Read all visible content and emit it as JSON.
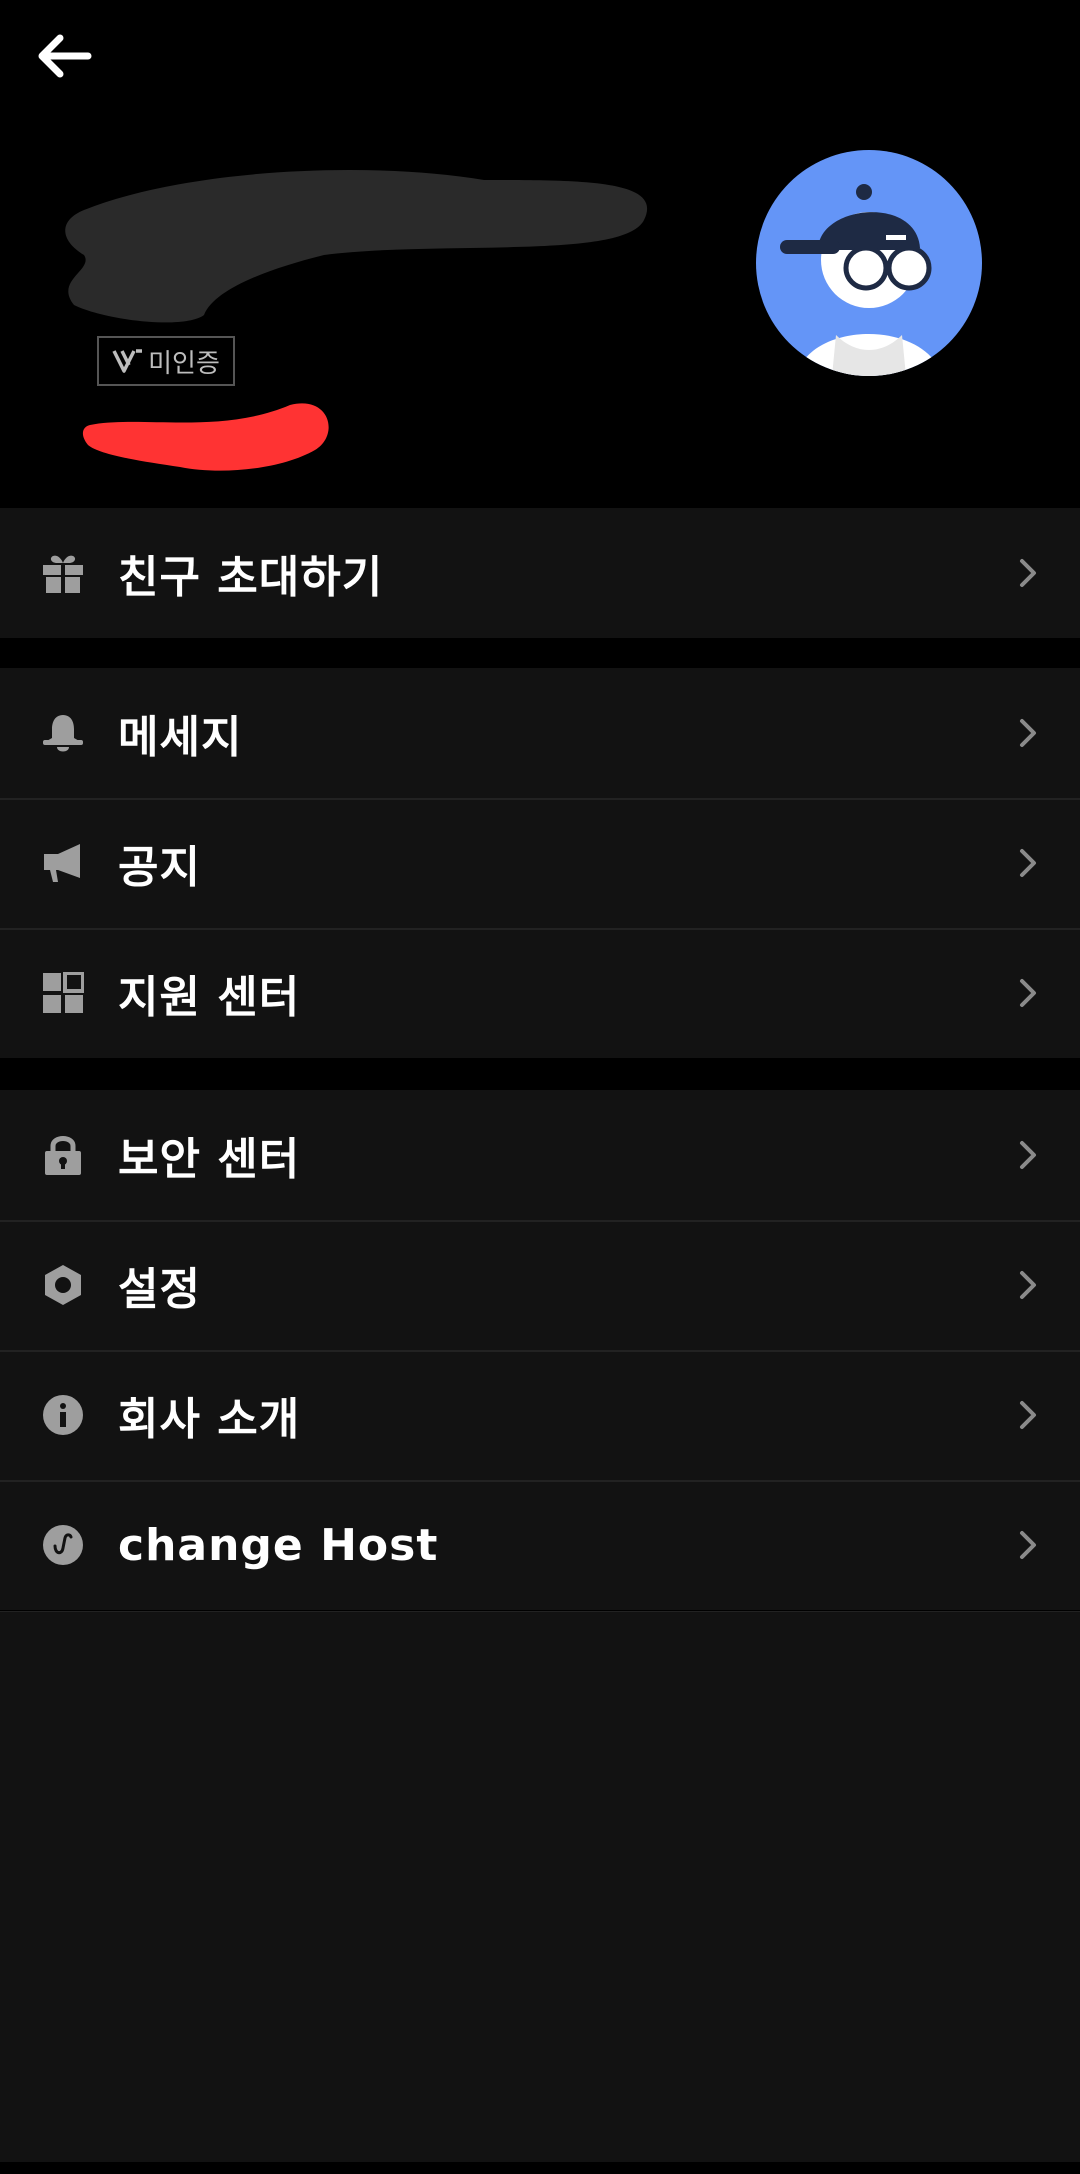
{
  "header": {
    "badge_label": "미인증"
  },
  "menu": {
    "invite": {
      "label": "친구 초대하기",
      "icon": "gift-icon"
    },
    "messages": {
      "label": "메세지",
      "icon": "bell-icon"
    },
    "notice": {
      "label": "공지",
      "icon": "megaphone-icon"
    },
    "support": {
      "label": "지원 센터",
      "icon": "grid-icon"
    },
    "security": {
      "label": "보안 센터",
      "icon": "lock-icon"
    },
    "settings": {
      "label": "설정",
      "icon": "hexagon-nut-icon"
    },
    "about": {
      "label": "회사 소개",
      "icon": "info-icon"
    },
    "change_host": {
      "label": "change Host",
      "icon": "host-icon"
    }
  },
  "colors": {
    "background": "#000000",
    "surface": "#121212",
    "icon": "#9e9e9e",
    "avatar_bg": "#6495f7",
    "redaction_grey": "#2a2a2a",
    "redaction_red": "#ff3333"
  }
}
